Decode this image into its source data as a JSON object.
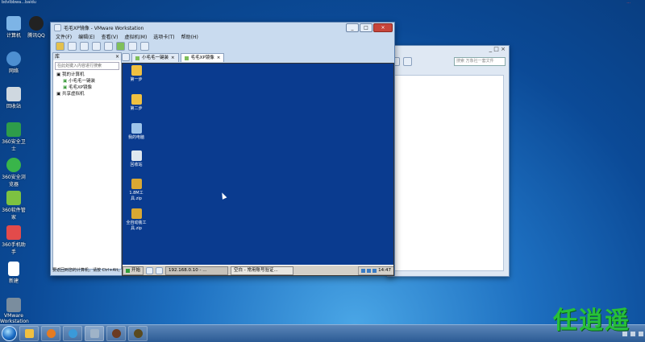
{
  "top_left_text": "bdvlbbwa...baidu",
  "top_right_text": "...",
  "desktop_icons": [
    {
      "label": "计算机",
      "icon": "computer-icon",
      "color": "#7db4e6"
    },
    {
      "label": "腾讯QQ",
      "icon": "qq-icon",
      "color": "#222222"
    },
    {
      "label": "网络",
      "icon": "network-icon",
      "color": "#4d8fd1"
    },
    {
      "label": "回收站",
      "icon": "recycle-bin-icon",
      "color": "#cfd8e0"
    },
    {
      "label": "360安全卫士",
      "icon": "security-icon",
      "color": "#2e9c4a"
    },
    {
      "label": "360安全浏览器",
      "icon": "browser-icon",
      "color": "#39b54a"
    },
    {
      "label": "360软件管家",
      "icon": "software-manager-icon",
      "color": "#7dc241"
    },
    {
      "label": "360手机助手",
      "icon": "phone-helper-icon",
      "color": "#e24b4b"
    },
    {
      "label": "新建",
      "icon": "file-icon",
      "color": "#ffffff"
    },
    {
      "label": "VMware Workstation",
      "icon": "vmware-icon",
      "color": "#7a8d9e"
    }
  ],
  "explorer": {
    "title_buttons": "_ □ ×",
    "search_placeholder": "搜索 万象社一套文件"
  },
  "vmware": {
    "title": "毛毛XP镜像 - VMware Workstation",
    "menu": [
      "文件(F)",
      "编辑(E)",
      "查看(V)",
      "虚拟机(M)",
      "选项卡(T)",
      "帮助(H)"
    ],
    "library": {
      "header": "库",
      "search_placeholder": "在此处键入内容进行搜索",
      "tree": [
        "我的计算机",
        "小毛毛一键装",
        "毛毛XP镜像",
        "共享虚拟机"
      ]
    },
    "tabs": [
      "小毛毛一键装",
      "毛毛XP镜像"
    ],
    "status": "要返回到您的计算机，请按 Ctrl+Alt。"
  },
  "guest": {
    "icons": [
      "第一步",
      "第二步",
      "我的电脑",
      "回收站",
      "1.8M工具.zip",
      "全自动装工具.zip"
    ],
    "start_label": "开始",
    "tasks": [
      "192.168.0.10 - ...",
      "空白 - 常用账号验证..."
    ],
    "clock": "14:47"
  },
  "taskbar_items": [
    "explorer",
    "media-player",
    "ie",
    "vmware",
    "game1",
    "game2"
  ],
  "watermark": "任逍遥"
}
